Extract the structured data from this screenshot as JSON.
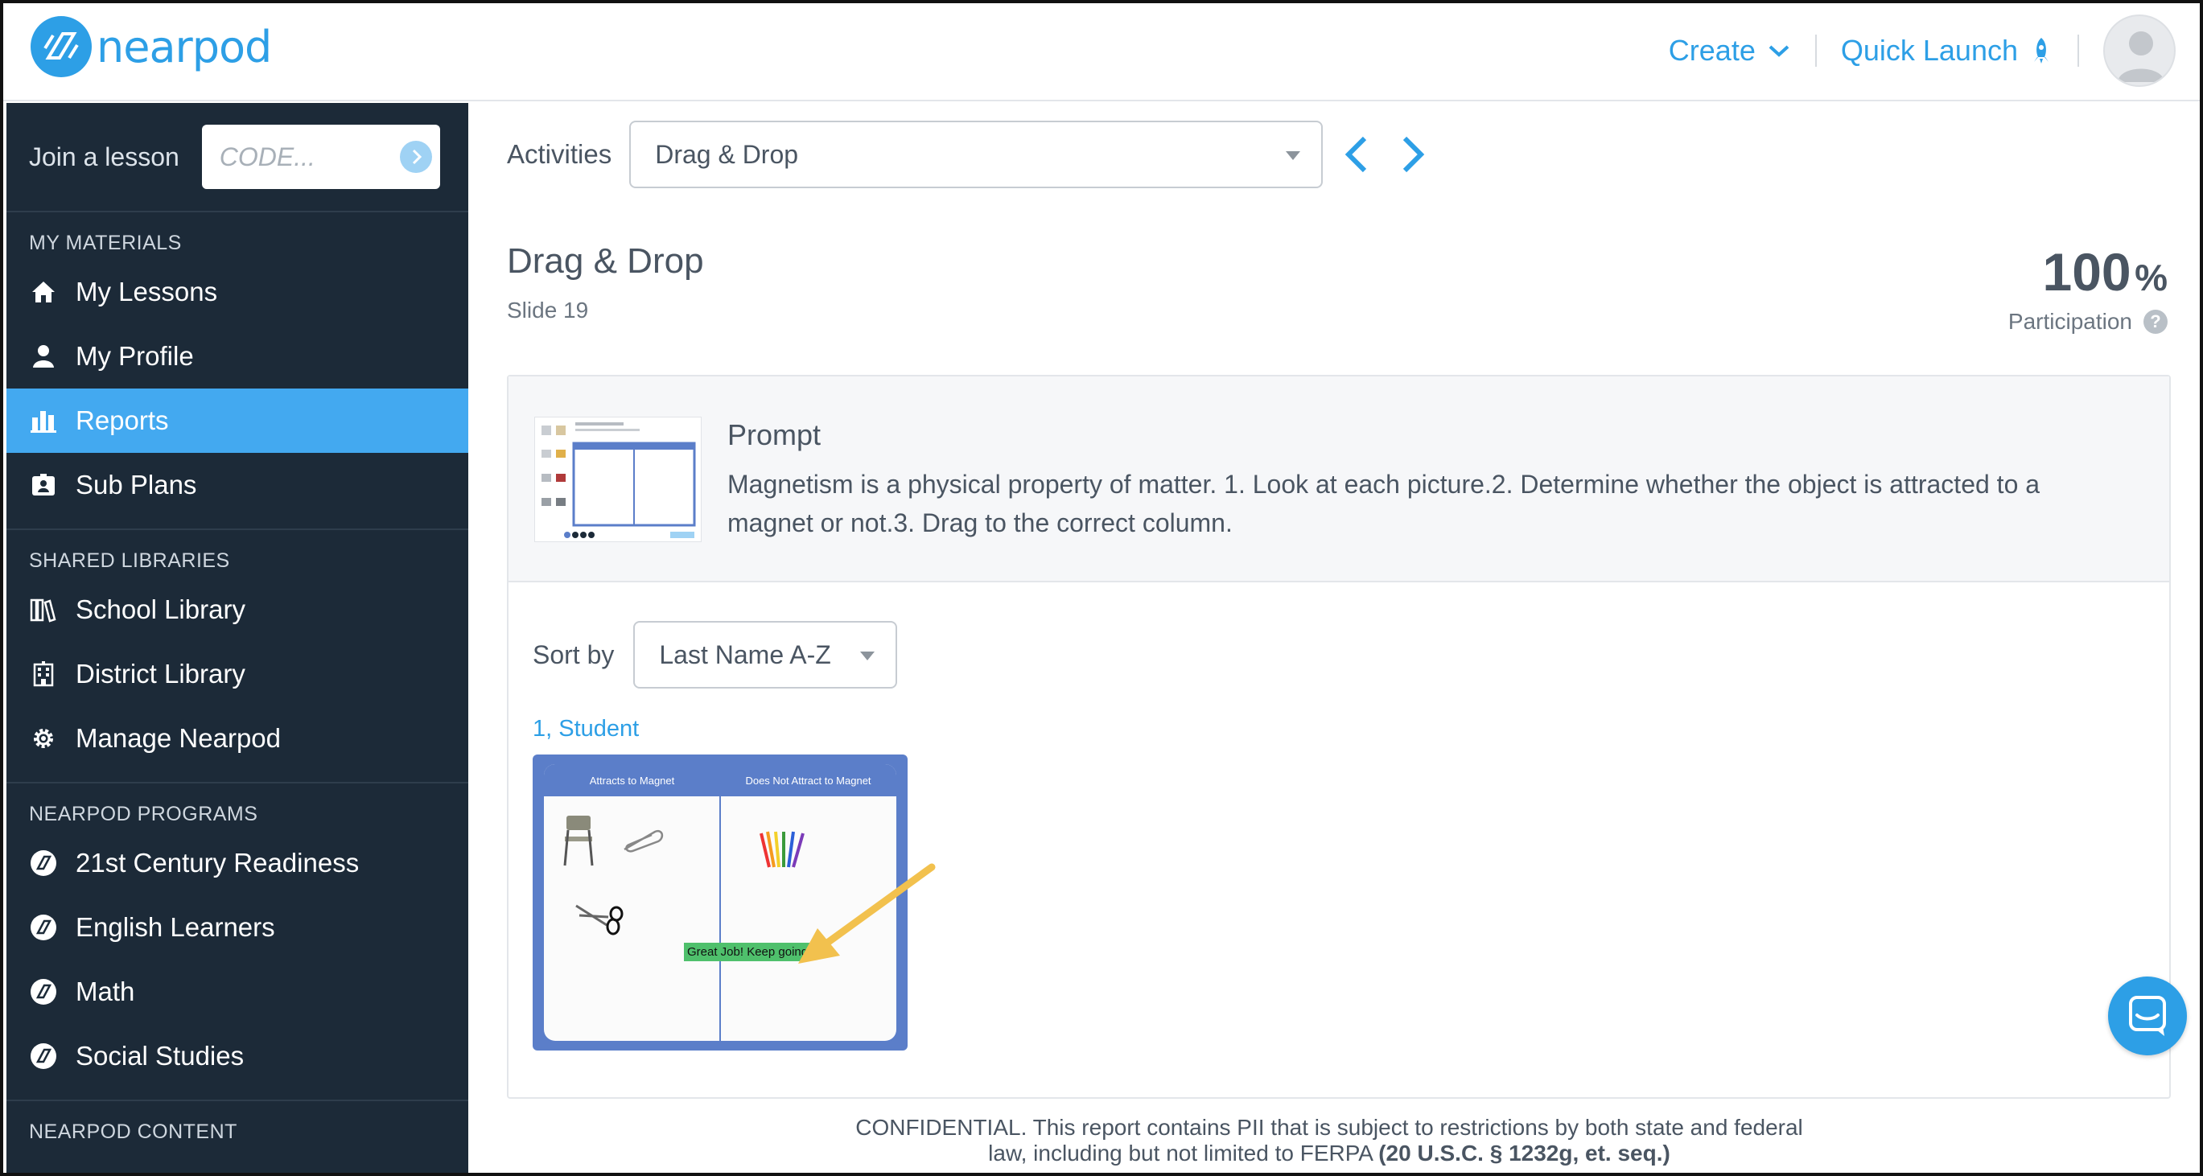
{
  "header": {
    "logo_text": "nearpod",
    "create_label": "Create",
    "quick_launch_label": "Quick Launch"
  },
  "sidebar": {
    "join_label": "Join a lesson",
    "join_placeholder": "CODE...",
    "sections": [
      {
        "title": "MY MATERIALS",
        "items": [
          {
            "label": "My Lessons",
            "icon": "home-icon"
          },
          {
            "label": "My Profile",
            "icon": "user-icon"
          },
          {
            "label": "Reports",
            "icon": "bar-chart-icon",
            "active": true
          },
          {
            "label": "Sub Plans",
            "icon": "id-badge-icon"
          }
        ]
      },
      {
        "title": "SHARED LIBRARIES",
        "items": [
          {
            "label": "School Library",
            "icon": "books-icon"
          },
          {
            "label": "District Library",
            "icon": "building-icon"
          },
          {
            "label": "Manage Nearpod",
            "icon": "gear-icon"
          }
        ]
      },
      {
        "title": "NEARPOD PROGRAMS",
        "items": [
          {
            "label": "21st Century Readiness",
            "icon": "nearpod-icon"
          },
          {
            "label": "English Learners",
            "icon": "nearpod-icon"
          },
          {
            "label": "Math",
            "icon": "nearpod-icon"
          },
          {
            "label": "Social Studies",
            "icon": "nearpod-icon"
          }
        ]
      },
      {
        "title": "NEARPOD CONTENT",
        "items": []
      }
    ]
  },
  "main": {
    "activities_label": "Activities",
    "activities_value": "Drag & Drop",
    "slide_title": "Drag & Drop",
    "slide_sub": "Slide 19",
    "participation_value": "100",
    "participation_unit": "%",
    "participation_label": "Participation",
    "prompt_title": "Prompt",
    "prompt_text": "Magnetism is a physical property of matter. 1. Look at each picture.2. Determine whether the object is attracted to a magnet or not.3. Drag to the correct column.",
    "sort_label": "Sort by",
    "sort_value": "Last Name A-Z",
    "student_name": "1, Student",
    "student_response": {
      "col1": "Attracts to Magnet",
      "col2": "Does Not Attract to Magnet",
      "badge": "Great Job! Keep going"
    },
    "confidential_text": "CONFIDENTIAL. This report contains PII that is subject to restrictions by both state and federal law, including but not limited to FERPA",
    "confidential_bold": "(20 U.S.C. § 1232g, et. seq.)"
  },
  "colors": {
    "accent": "#2d9fe6",
    "sidebar_bg": "#1c2a38",
    "active_item": "#43a9f0"
  }
}
